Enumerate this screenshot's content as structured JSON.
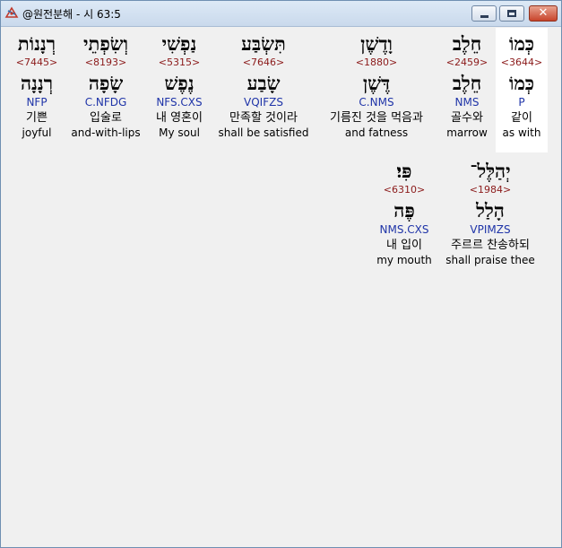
{
  "window": {
    "title": "@원전분해 - 시 63:5",
    "minimize_label": "",
    "maximize_label": "",
    "close_label": "✕"
  },
  "rows": [
    [
      {
        "heb": "כְּמוֹ",
        "strong": "<3644>",
        "lemma": "כְּמוֹ",
        "parse": "P",
        "ko": "같이",
        "en": "as with"
      },
      {
        "heb": "חֵלֶב",
        "strong": "<2459>",
        "lemma": "חֵלֶב",
        "parse": "NMS",
        "ko": "골수와",
        "en": "marrow"
      },
      {
        "heb": "וָדֶשֶׁן",
        "strong": "<1880>",
        "lemma": "דֶּשֶׁן",
        "parse": "C.NMS",
        "ko": "기름진 것을 먹음과",
        "en": "and fatness"
      },
      {
        "heb": "תִּשְׂבַּע",
        "strong": "<7646>",
        "lemma": "שָׂבַע",
        "parse": "VQIFZS",
        "ko": "만족할 것이라",
        "en": "shall be satisfied"
      },
      {
        "heb": "נַפְשִׁי",
        "strong": "<5315>",
        "lemma": "נֶפֶשׁ",
        "parse": "NFS.CXS",
        "ko": "내 영혼이",
        "en": "My soul"
      },
      {
        "heb": "וְשִׂפְתֵי",
        "strong": "<8193>",
        "lemma": "שָׂפָה",
        "parse": "C.NFDG",
        "ko": "입술로",
        "en": "and-with-lips"
      },
      {
        "heb": "רְנָנוֹת",
        "strong": "<7445>",
        "lemma": "רְנָנָה",
        "parse": "NFP",
        "ko": "기쁜",
        "en": "joyful"
      }
    ],
    [
      {
        "heb": "יְהַלֶּל־",
        "strong": "<1984>",
        "lemma": "הָלַל",
        "parse": "VPIMZS",
        "ko": "주르르 찬송하되",
        "en": "shall praise thee"
      },
      {
        "heb": "פִּי׃",
        "strong": "<6310>",
        "lemma": "פֶּה",
        "parse": "NMS.CXS",
        "ko": "내 입이",
        "en": "my mouth"
      }
    ]
  ]
}
